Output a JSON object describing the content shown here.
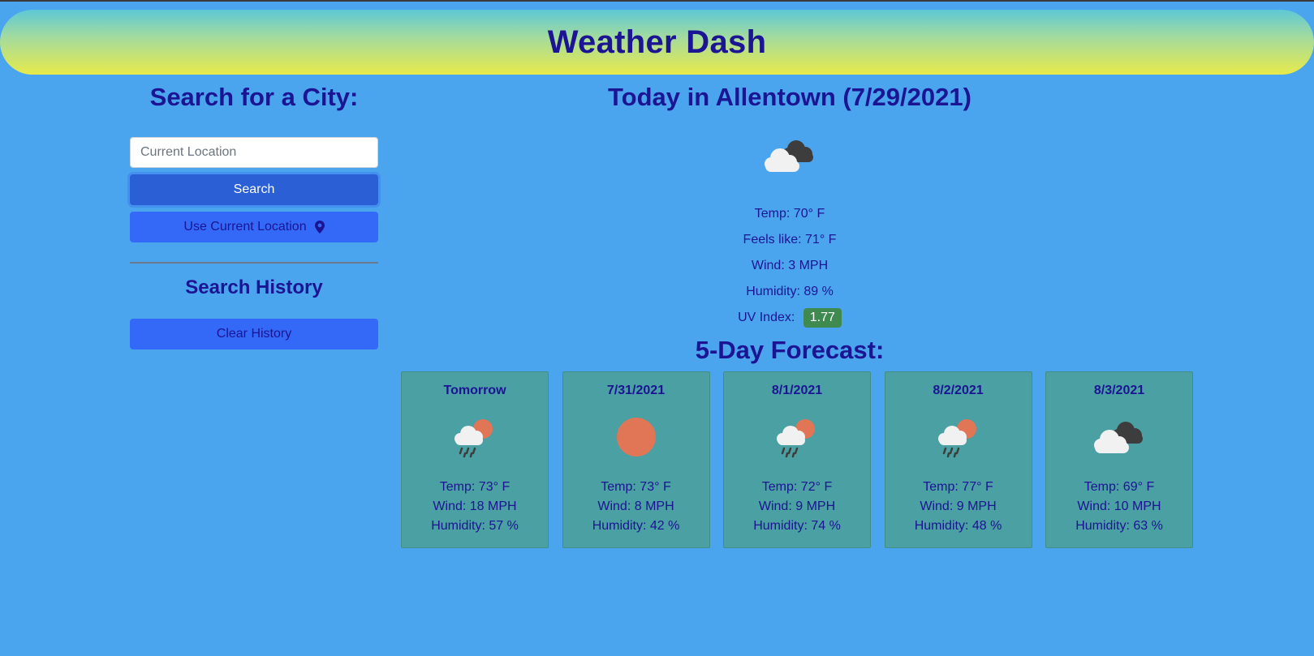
{
  "app": {
    "title": "Weather Dash"
  },
  "sidebar": {
    "search_heading": "Search for a City:",
    "search_placeholder": "Current Location",
    "search_label": "Search",
    "use_location_label": "Use Current Location",
    "history_heading": "Search History",
    "clear_history_label": "Clear History"
  },
  "today": {
    "title": "Today in Allentown (7/29/2021)",
    "icon": "broken-clouds-icon",
    "temp": "Temp: 70° F",
    "feels_like": "Feels like: 71° F",
    "wind": "Wind: 3 MPH",
    "humidity": "Humidity: 89 %",
    "uv_label": "UV Index:",
    "uv_value": "1.77"
  },
  "forecast": {
    "title": "5-Day Forecast:",
    "days": [
      {
        "date": "Tomorrow",
        "icon": "rain-sun-icon",
        "temp": "Temp: 73° F",
        "wind": "Wind: 18 MPH",
        "humidity": "Humidity: 57 %"
      },
      {
        "date": "7/31/2021",
        "icon": "sun-icon",
        "temp": "Temp: 73° F",
        "wind": "Wind: 8 MPH",
        "humidity": "Humidity: 42 %"
      },
      {
        "date": "8/1/2021",
        "icon": "rain-sun-icon",
        "temp": "Temp: 72° F",
        "wind": "Wind: 9 MPH",
        "humidity": "Humidity: 74 %"
      },
      {
        "date": "8/2/2021",
        "icon": "rain-sun-icon",
        "temp": "Temp: 77° F",
        "wind": "Wind: 9 MPH",
        "humidity": "Humidity: 48 %"
      },
      {
        "date": "8/3/2021",
        "icon": "broken-clouds-icon",
        "temp": "Temp: 69° F",
        "wind": "Wind: 10 MPH",
        "humidity": "Humidity: 63 %"
      }
    ]
  },
  "colors": {
    "background": "#4ba5ee",
    "heading": "#1b1493",
    "button": "#3469f8",
    "card": "#4aa0a3",
    "uv_badge": "#3f8a4f",
    "sun": "#e07656"
  }
}
